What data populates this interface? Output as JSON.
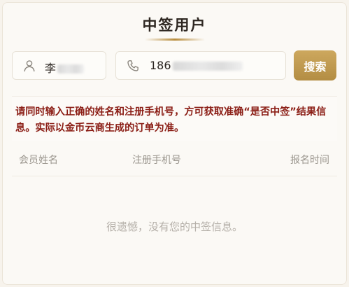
{
  "header": {
    "title": "中签用户"
  },
  "form": {
    "name_value": "李",
    "phone_value": "186",
    "search_label": "搜索"
  },
  "notice": {
    "text": "请同时输入正确的姓名和注册手机号，方可获取准确“是否中签”结果信息。实际以金币云商生成的订单为准。"
  },
  "table": {
    "columns": [
      "会员姓名",
      "注册手机号",
      "报名时间"
    ],
    "rows": []
  },
  "empty_state": {
    "text": "很遗憾，没有您的中签信息。"
  },
  "colors": {
    "accent": "#b8913f",
    "notice": "#8b1e16",
    "muted": "#9a958d"
  },
  "icons": {
    "name_field": "user-icon",
    "phone_field": "phone-icon"
  }
}
